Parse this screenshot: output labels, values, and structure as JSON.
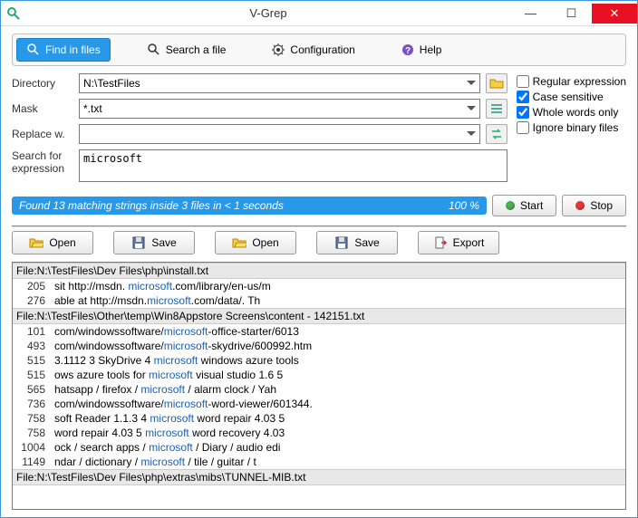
{
  "window": {
    "title": "V-Grep"
  },
  "toolbar": {
    "find": "Find in files",
    "search": "Search a file",
    "config": "Configuration",
    "help": "Help"
  },
  "form": {
    "dir_label": "Directory",
    "dir_value": "N:\\TestFiles",
    "mask_label": "Mask",
    "mask_value": "*.txt",
    "replace_label": "Replace w.",
    "replace_value": "",
    "search_label": "Search for expression",
    "search_value": "microsoft"
  },
  "checks": {
    "regex": {
      "label": "Regular expression",
      "checked": false
    },
    "case": {
      "label": "Case sensitive",
      "checked": true
    },
    "whole": {
      "label": "Whole words only",
      "checked": true
    },
    "binary": {
      "label": "Ignore binary files",
      "checked": false
    }
  },
  "status": {
    "text": "Found 13 matching strings inside 3 files in < 1 seconds",
    "pct": "100 %",
    "start": "Start",
    "stop": "Stop"
  },
  "actions": {
    "open1": "Open",
    "save1": "Save",
    "open2": "Open",
    "save2": "Save",
    "export": "Export"
  },
  "results": [
    {
      "type": "file",
      "text": "File:N:\\TestFiles\\Dev Files\\php\\install.txt"
    },
    {
      "type": "line",
      "num": "205",
      "pre": "sit  http://msdn.  ",
      "hl": "microsoft",
      "post": ".com/library/en-us/m"
    },
    {
      "type": "line",
      "num": "276",
      "pre": "able at http://msdn.",
      "hl": "microsoft",
      "post": ".com/data/.   Th"
    },
    {
      "type": "file",
      "text": "File:N:\\TestFiles\\Other\\temp\\Win8Appstore Screens\\content - 142151.txt"
    },
    {
      "type": "line",
      "num": "101",
      "pre": "com/windowssoftware/",
      "hl": "microsoft",
      "post": "-office-starter/6013"
    },
    {
      "type": "line",
      "num": "493",
      "pre": "com/windowssoftware/",
      "hl": "microsoft",
      "post": "-skydrive/600992.htm"
    },
    {
      "type": "line",
      "num": "515",
      "pre": "3.1112 3 SkyDrive 4 ",
      "hl": "microsoft",
      "post": " windows azure tools"
    },
    {
      "type": "line",
      "num": "515",
      "pre": "ows azure tools for ",
      "hl": "microsoft",
      "post": " visual studio 1.6 5"
    },
    {
      "type": "line",
      "num": "565",
      "pre": "hatsapp / firefox / ",
      "hl": "microsoft",
      "post": " / alarm clock / Yah"
    },
    {
      "type": "line",
      "num": "736",
      "pre": "com/windowssoftware/",
      "hl": "microsoft",
      "post": "-word-viewer/601344."
    },
    {
      "type": "line",
      "num": "758",
      "pre": "soft Reader 1.1.3 4 ",
      "hl": "microsoft",
      "post": " word repair 4.03 5"
    },
    {
      "type": "line",
      "num": "758",
      "pre": " word repair 4.03 5 ",
      "hl": "microsoft",
      "post": " word recovery 4.03"
    },
    {
      "type": "line",
      "num": "1004",
      "pre": "ock / search apps / ",
      "hl": "microsoft",
      "post": " / Diary / audio edi"
    },
    {
      "type": "line",
      "num": "1149",
      "pre": "ndar / dictionary / ",
      "hl": "microsoft",
      "post": " / tile / guitar / t"
    },
    {
      "type": "file",
      "text": "File:N:\\TestFiles\\Dev Files\\php\\extras\\mibs\\TUNNEL-MIB.txt"
    }
  ]
}
